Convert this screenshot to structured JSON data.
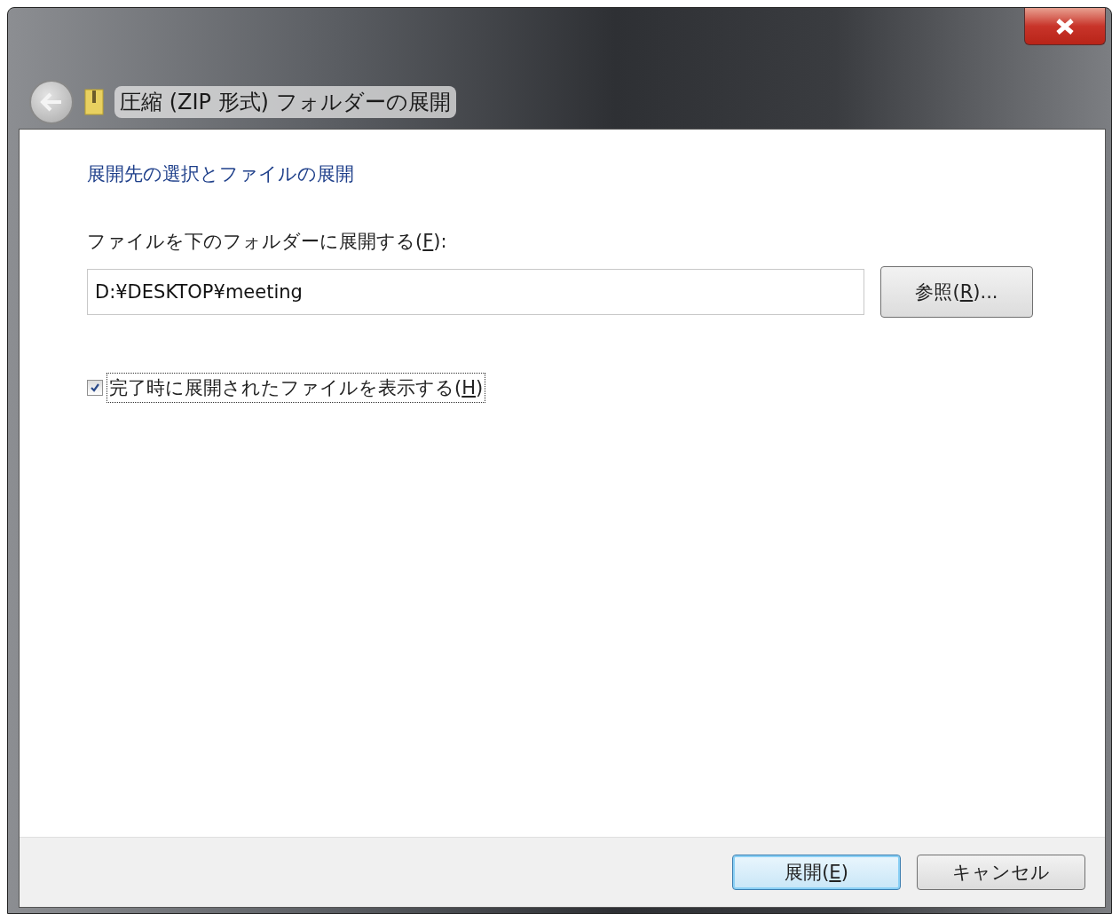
{
  "window": {
    "title": "圧縮 (ZIP 形式) フォルダーの展開"
  },
  "heading": "展開先の選択とファイルの展開",
  "folder_label": {
    "before": "ファイルを下のフォルダーに展開する(",
    "key": "F",
    "after": "):"
  },
  "folder_field": {
    "value": "D:¥DESKTOP¥meeting"
  },
  "browse_button": {
    "before": "参照(",
    "key": "R",
    "after": ")..."
  },
  "show_files": {
    "before": "完了時に展開されたファイルを表示する(",
    "key": "H",
    "after": ")",
    "checked": true,
    "focused": true
  },
  "buttons": [
    {
      "before": "展開(",
      "key": "E",
      "after": ")",
      "default": true
    },
    {
      "before": "キャンセル",
      "default": false
    }
  ]
}
